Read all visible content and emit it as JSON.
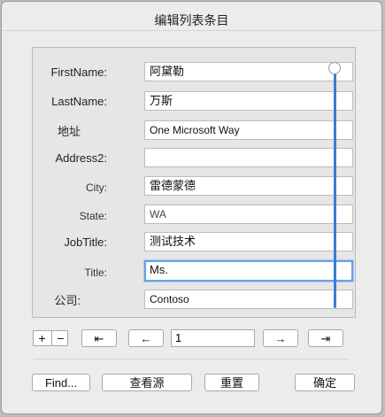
{
  "window": {
    "title": "编辑列表条目"
  },
  "form": {
    "rows": [
      {
        "label": "FirstName:",
        "value": "阿黛勒"
      },
      {
        "label": "LastName:",
        "value": "万斯"
      },
      {
        "label": "地址",
        "value": "One Microsoft Way"
      },
      {
        "label": "Address2:",
        "value": ""
      },
      {
        "label": "City:",
        "value": "雷德蒙德"
      },
      {
        "label": "State:",
        "value": "WA"
      },
      {
        "label": "JobTitle:",
        "value": "测试技术"
      },
      {
        "label": "Title:",
        "value": "Ms."
      },
      {
        "label": "公司:",
        "value": "Contoso"
      }
    ]
  },
  "nav": {
    "add_label": "+",
    "remove_label": "−",
    "first_label": "⇤",
    "prev_label": "←",
    "record_number": "1",
    "next_label": "→",
    "last_label": "⇥"
  },
  "buttons": {
    "find_label": "Find...",
    "view_source_label": "查看源",
    "reset_label": "重置",
    "ok_label": "确定"
  }
}
